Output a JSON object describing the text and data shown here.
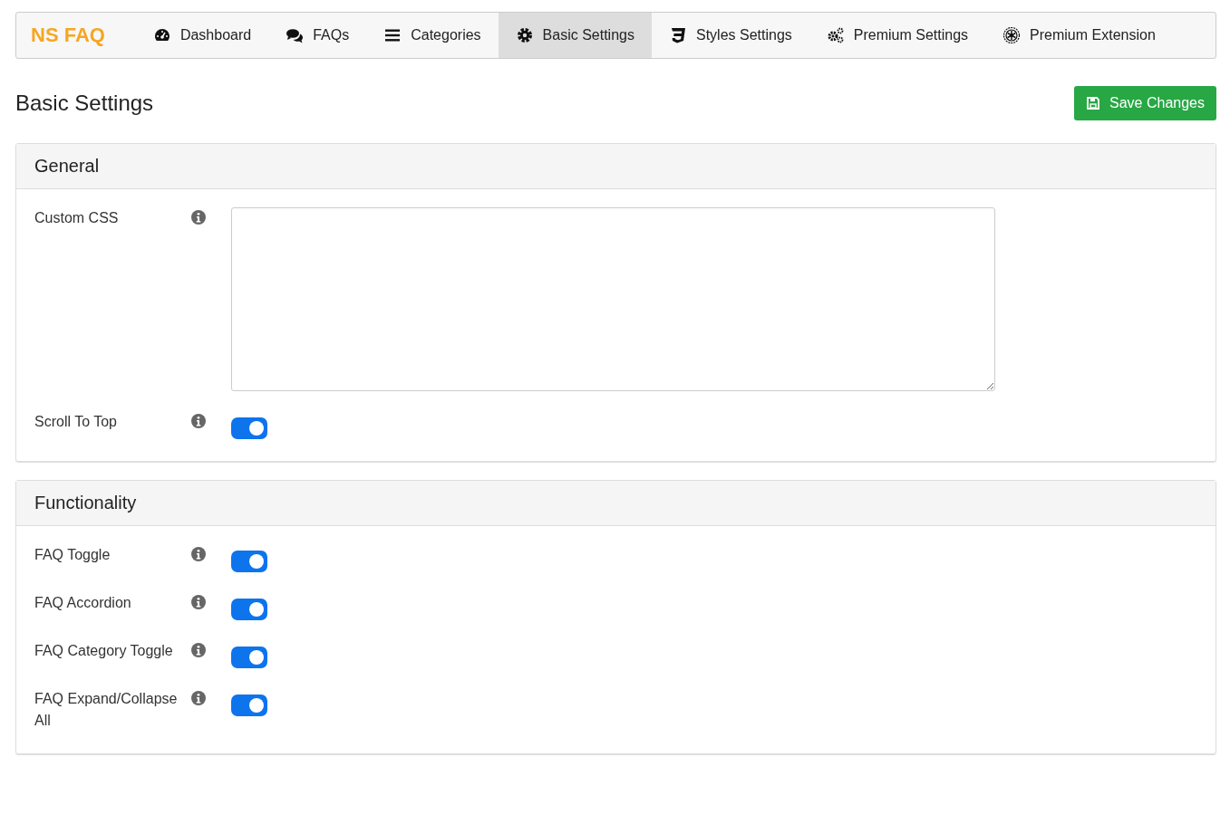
{
  "brand": "NS FAQ",
  "nav": [
    {
      "label": "Dashboard",
      "kind": "dashboard",
      "selected": false
    },
    {
      "label": "FAQs",
      "kind": "comments",
      "selected": false
    },
    {
      "label": "Categories",
      "kind": "bars",
      "selected": false
    },
    {
      "label": "Basic Settings",
      "kind": "cog",
      "selected": true
    },
    {
      "label": "Styles Settings",
      "kind": "css",
      "selected": false
    },
    {
      "label": "Premium Settings",
      "kind": "cogs",
      "selected": false
    },
    {
      "label": "Premium Extension",
      "kind": "emblem",
      "selected": false
    }
  ],
  "page_title": "Basic Settings",
  "save_button": "Save Changes",
  "sections": [
    {
      "title": "General",
      "fields": [
        {
          "label": "Custom CSS",
          "kind": "textarea"
        },
        {
          "label": "Scroll To Top",
          "kind": "toggle",
          "on": true
        }
      ]
    },
    {
      "title": "Functionality",
      "fields": [
        {
          "label": "FAQ Toggle",
          "kind": "toggle",
          "on": true
        },
        {
          "label": "FAQ Accordion",
          "kind": "toggle",
          "on": true
        },
        {
          "label": "FAQ Category Toggle",
          "kind": "toggle",
          "on": true
        },
        {
          "label": "FAQ Expand/Collapse All",
          "kind": "toggle",
          "on": true
        }
      ]
    }
  ]
}
